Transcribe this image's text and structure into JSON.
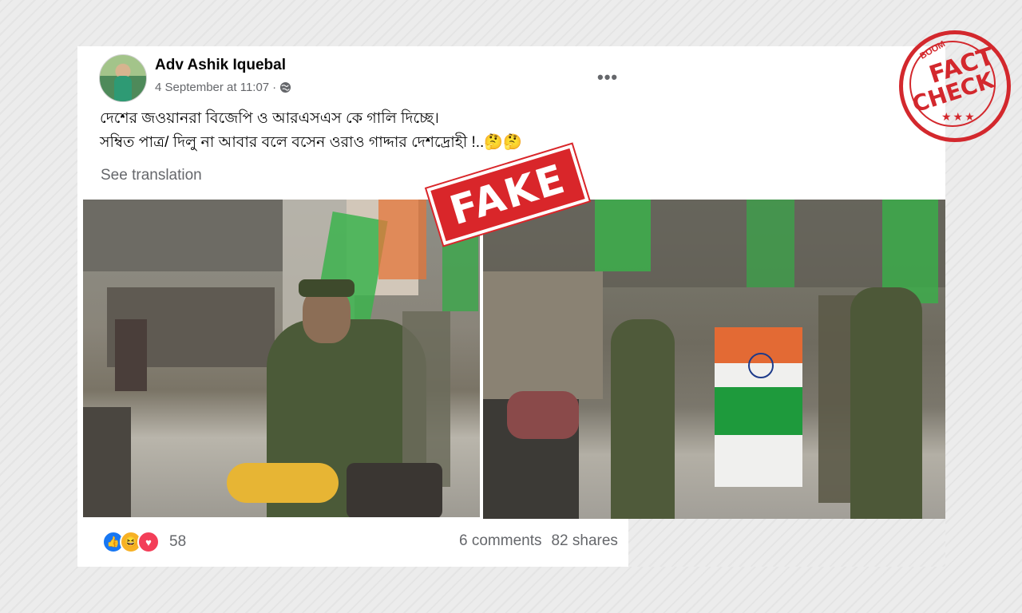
{
  "post": {
    "author": "Adv Ashik Iquebal",
    "timestamp": "4 September at 11:07",
    "separator": "·",
    "privacy_icon": "globe-icon",
    "more_label": "•••",
    "text_line1": "দেশের জওয়ানরা বিজেপি ও আরএসএস কে গালি দিচ্ছে।",
    "text_line2": "সম্বিত পাত্র/ দিলু না আবার বলে বসেন ওরাও গাদ্দার দেশদ্রোহী !..🤔🤔",
    "see_translation": "See translation"
  },
  "reactions": {
    "icons": [
      "like-icon",
      "haha-icon",
      "love-icon"
    ],
    "count": "58"
  },
  "stats": {
    "comments": "6 comments",
    "shares": "82 shares"
  },
  "overlays": {
    "fake_label": "FAKE",
    "stamp_brand": "BOOM",
    "stamp_line1": "FACT",
    "stamp_line2": "CHECK",
    "stamp_stars": "★★★"
  },
  "colors": {
    "fake_red": "#d9262a",
    "like_blue": "#1877f2",
    "haha_yellow": "#f7b125",
    "love_red": "#f33e58"
  }
}
